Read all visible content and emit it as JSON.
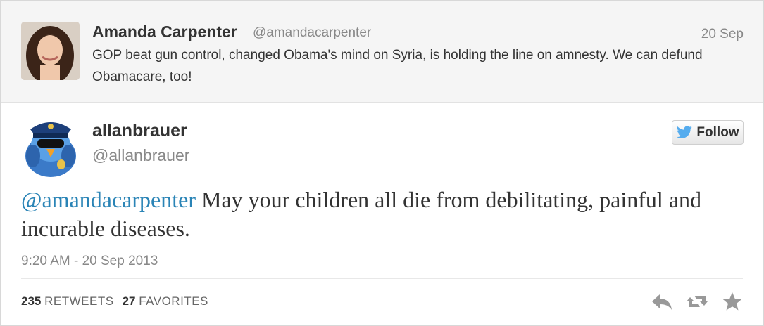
{
  "parent_tweet": {
    "name": "Amanda Carpenter",
    "handle": "@amandacarpenter",
    "date": "20 Sep",
    "text": "GOP beat gun control, changed Obama's mind on Syria, is holding the line on amnesty. We can defund Obamacare, too!"
  },
  "tweet": {
    "name": "allanbrauer",
    "handle": "@allanbrauer",
    "follow_label": "Follow",
    "mention": "@amandacarpenter",
    "text": " May your children all die from debilitating, painful and incurable diseases.",
    "timestamp": "9:20 AM - 20 Sep 2013"
  },
  "stats": {
    "retweets_count": "235",
    "retweets_label": "RETWEETS",
    "favorites_count": "27",
    "favorites_label": "FAVORITES"
  },
  "icons": {
    "reply": "reply-icon",
    "retweet": "retweet-icon",
    "favorite": "star-icon",
    "follow": "twitter-bird-icon"
  },
  "colors": {
    "mention": "#2a84b6",
    "header_bg": "#f5f5f5",
    "twitter_blue": "#55acee",
    "muted": "#888888"
  }
}
